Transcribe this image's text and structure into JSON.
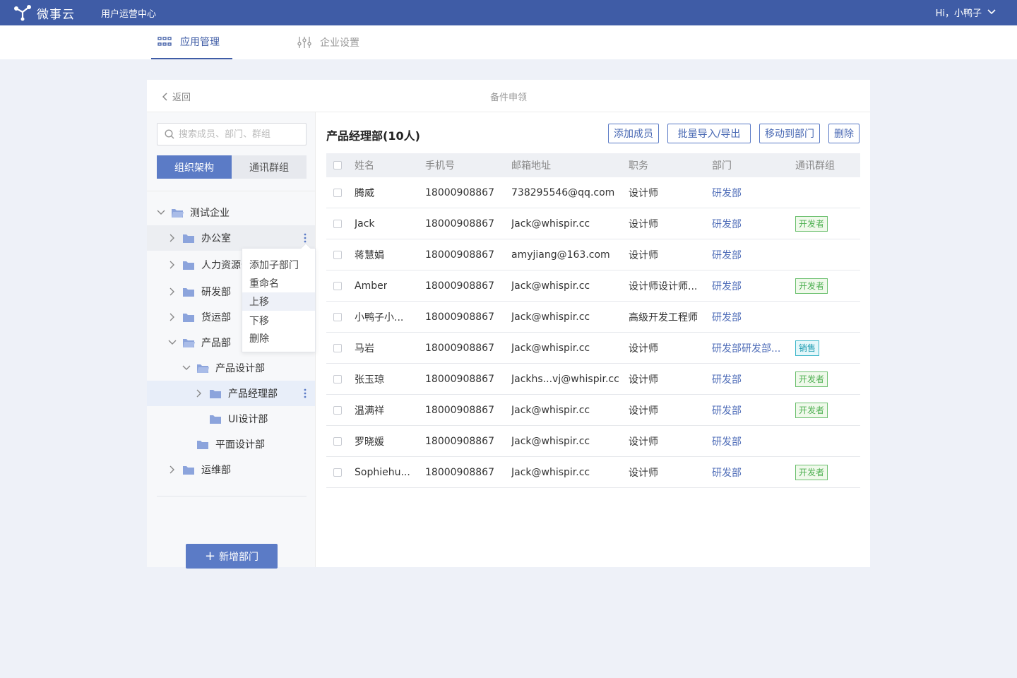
{
  "header": {
    "logo_text": "微事云",
    "center_name": "用户运营中心",
    "greeting": "Hi，小鸭子"
  },
  "nav": {
    "tabs": [
      {
        "label": "应用管理",
        "active": true,
        "icon": "grid-icon"
      },
      {
        "label": "企业设置",
        "active": false,
        "icon": "sliders-icon"
      }
    ]
  },
  "page": {
    "back_label": "返回",
    "title": "备件申领"
  },
  "sidebar": {
    "search_placeholder": "搜索成员、部门、群组",
    "segments": [
      "组织架构",
      "通讯群组"
    ],
    "tree": [
      {
        "label": "测试企业",
        "level": 0,
        "expanded": true
      },
      {
        "label": "办公室",
        "level": 1,
        "expanded": false
      },
      {
        "label": "人力资源部",
        "level": 1,
        "expanded": false
      },
      {
        "label": "研发部",
        "level": 1,
        "expanded": false
      },
      {
        "label": "货运部",
        "level": 1,
        "expanded": false
      },
      {
        "label": "产品部",
        "level": 1,
        "expanded": true
      },
      {
        "label": "产品设计部",
        "level": 2,
        "expanded": true
      },
      {
        "label": "产品经理部",
        "level": 3,
        "expanded": false,
        "selected": true
      },
      {
        "label": "UI设计部",
        "level": 3
      },
      {
        "label": "平面设计部",
        "level": 2
      },
      {
        "label": "运维部",
        "level": 1,
        "expanded": false
      }
    ],
    "context_menu": [
      "添加子部门",
      "重命名",
      "上移",
      "下移",
      "删除"
    ],
    "add_dept_label": "新增部门"
  },
  "main": {
    "dept_title": "产品经理部(10人)",
    "buttons": [
      "添加成员",
      "批量导入/导出",
      "移动到部门",
      "删除"
    ],
    "columns": [
      "姓名",
      "手机号",
      "邮箱地址",
      "职务",
      "部门",
      "通讯群组"
    ],
    "rows": [
      {
        "name": "腾威",
        "phone": "18000908867",
        "email": "738295546@qq.com",
        "title": "设计师",
        "dept": "研发部",
        "group": ""
      },
      {
        "name": "Jack",
        "phone": "18000908867",
        "email": "Jack@whispir.cc",
        "title": "设计师",
        "dept": "研发部",
        "group": "开发者"
      },
      {
        "name": "蒋慧娟",
        "phone": "18000908867",
        "email": "amyjiang@163.com",
        "title": "设计师",
        "dept": "研发部",
        "group": ""
      },
      {
        "name": "Amber",
        "phone": "18000908867",
        "email": "Jack@whispir.cc",
        "title": "设计师设计师...",
        "dept": "研发部",
        "group": "开发者"
      },
      {
        "name": "小鸭子小...",
        "phone": "18000908867",
        "email": "Jack@whispir.cc",
        "title": "高级开发工程师",
        "dept": "研发部",
        "group": ""
      },
      {
        "name": "马岩",
        "phone": "18000908867",
        "email": "Jack@whispir.cc",
        "title": "设计师",
        "dept": "研发部研发部...",
        "group": "销售"
      },
      {
        "name": "张玉琼",
        "phone": "18000908867",
        "email": "Jackhs...vj@whispir.cc",
        "title": "设计师",
        "dept": "研发部",
        "group": "开发者"
      },
      {
        "name": "温满祥",
        "phone": "18000908867",
        "email": "Jack@whispir.cc",
        "title": "设计师",
        "dept": "研发部",
        "group": "开发者"
      },
      {
        "name": "罗晓媛",
        "phone": "18000908867",
        "email": "Jack@whispir.cc",
        "title": "设计师",
        "dept": "研发部",
        "group": ""
      },
      {
        "name": "Sophiehu...",
        "phone": "18000908867",
        "email": "Jack@whispir.cc",
        "title": "设计师",
        "dept": "研发部",
        "group": "开发者"
      }
    ]
  },
  "colors": {
    "primary": "#3f5ca6",
    "accent": "#5b7bc6",
    "tag_dev": "#4caf50",
    "tag_sale": "#1a9bb0"
  }
}
